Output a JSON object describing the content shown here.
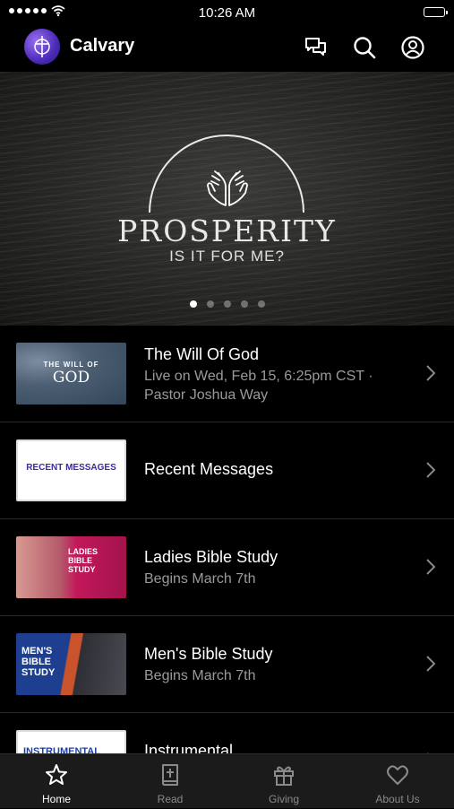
{
  "status_bar": {
    "time": "10:26 AM"
  },
  "header": {
    "title": "Calvary"
  },
  "hero": {
    "title": "PROSPERITY",
    "subtitle": "IS IT FOR ME?",
    "slide_count": 5,
    "active_slide": 1
  },
  "list": {
    "items": [
      {
        "title": "The Will Of God",
        "subtitle_1": "Live on Wed, Feb 15, 6:25pm CST ·",
        "subtitle_2": "Pastor Joshua Way",
        "thumb_line_1": "THE WILL OF",
        "thumb_line_2": "GOD"
      },
      {
        "title": "Recent Messages",
        "thumb_text": "RECENT MESSAGES"
      },
      {
        "title": "Ladies Bible Study",
        "subtitle_1": "Begins March 7th",
        "thumb_line_1": "LADIES",
        "thumb_line_2": "BIBLE",
        "thumb_line_3": "STUDY"
      },
      {
        "title": "Men's Bible Study",
        "subtitle_1": "Begins March 7th",
        "thumb_line_1": "MEN'S",
        "thumb_line_2": "BIBLE",
        "thumb_line_3": "STUDY"
      },
      {
        "title": "Instrumental",
        "thumb_text": "INSTRUMENTAL"
      }
    ]
  },
  "tab_bar": {
    "tabs": [
      {
        "label": "Home",
        "icon": "star-icon",
        "active": true
      },
      {
        "label": "Read",
        "icon": "bible-icon",
        "active": false
      },
      {
        "label": "Giving",
        "icon": "gift-icon",
        "active": false
      },
      {
        "label": "About Us",
        "icon": "heart-icon",
        "active": false
      }
    ]
  },
  "colors": {
    "background": "#000000",
    "tab_bar": "#1b1b1b",
    "subtitle": "#9a9a9a",
    "logo": "#5a35c8",
    "ladies_accent": "#d8266f",
    "mens_accent": "#1e3f8f"
  }
}
